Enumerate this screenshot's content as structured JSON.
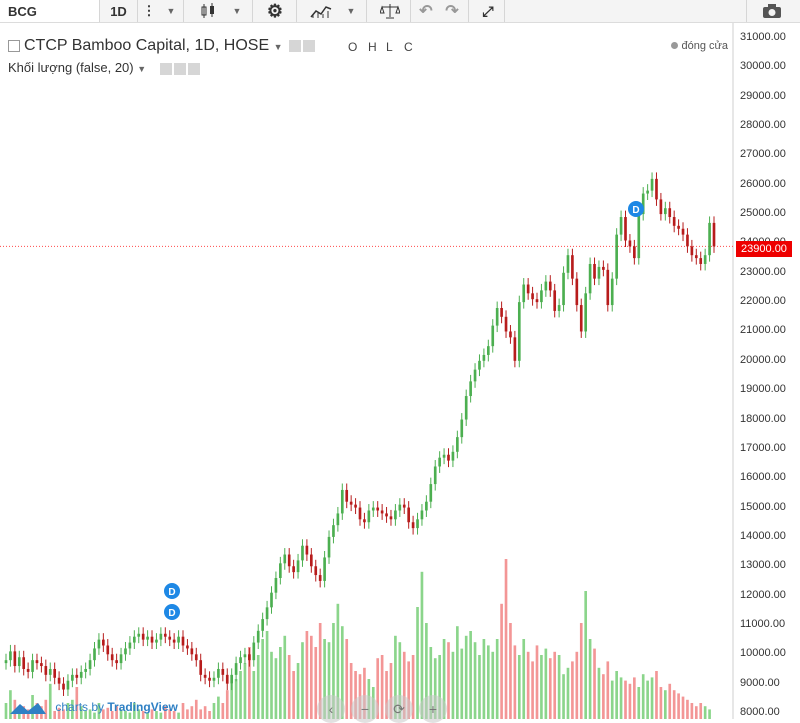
{
  "toolbar": {
    "symbol": "BCG",
    "resolution": "1D",
    "icons": [
      "more-icon",
      "candlestick-icon",
      "settings-icon",
      "indicators-icon",
      "compare-icon",
      "undo-icon",
      "redo-icon",
      "fullscreen-icon",
      "camera-icon"
    ]
  },
  "legend": {
    "title": "CTCP Bamboo Capital, 1D, HOSE",
    "ohlc": [
      "O",
      "H",
      "L",
      "C"
    ],
    "volume": "Khối lượng (false, 20)",
    "close_label": "đóng cửa"
  },
  "last_price": "23900.00",
  "branding": {
    "prefix": "charts by",
    "name": "TradingView"
  },
  "markers": [
    "D",
    "D",
    "D"
  ],
  "colors": {
    "up": "#4caf50",
    "down": "#b71c1c",
    "vol_up": "#7ed07e",
    "vol_down": "#f28b8b",
    "price_line": "#ff4a4a"
  },
  "chart_data": {
    "type": "candlestick",
    "title": "CTCP Bamboo Capital, 1D, HOSE",
    "y_ticks": [
      "31000.00",
      "30000.00",
      "29000.00",
      "28000.00",
      "27000.00",
      "26000.00",
      "25000.00",
      "24000.00",
      "23000.00",
      "22000.00",
      "21000.00",
      "20000.00",
      "19000.00",
      "18000.00",
      "17000.00",
      "16000.00",
      "15000.00",
      "14000.00",
      "13000.00",
      "12000.00",
      "11000.00",
      "10000.00",
      "9000.00",
      "8000.00"
    ],
    "ylim": [
      8000,
      31300
    ],
    "grid": false,
    "close": [
      9800,
      10100,
      9600,
      9900,
      9500,
      9400,
      9800,
      9700,
      9600,
      9300,
      9500,
      9200,
      9000,
      8800,
      9100,
      9300,
      9200,
      9400,
      9500,
      9800,
      10200,
      10500,
      10300,
      10000,
      9800,
      9700,
      10000,
      10200,
      10400,
      10600,
      10700,
      10500,
      10600,
      10400,
      10500,
      10700,
      10600,
      10500,
      10400,
      10600,
      10300,
      10200,
      10000,
      9800,
      9300,
      9200,
      9100,
      9200,
      9500,
      9300,
      9000,
      9300,
      9700,
      9900,
      10000,
      9800,
      10400,
      10800,
      11200,
      11600,
      12100,
      12600,
      13100,
      13400,
      13000,
      12800,
      13200,
      13700,
      13400,
      13000,
      12700,
      12500,
      13300,
      14000,
      14400,
      14800,
      15600,
      15200,
      15100,
      15000,
      14600,
      14500,
      14900,
      15000,
      14900,
      14800,
      14700,
      14600,
      14900,
      15100,
      15000,
      14500,
      14300,
      14600,
      14900,
      15200,
      15800,
      16400,
      16700,
      16800,
      16600,
      16900,
      17400,
      18000,
      18800,
      19300,
      19700,
      20000,
      20200,
      20500,
      21200,
      21800,
      21500,
      21000,
      20800,
      20000,
      22000,
      22600,
      22300,
      22100,
      22000,
      22400,
      22700,
      22400,
      21700,
      21900,
      23000,
      23600,
      22800,
      21900,
      21000,
      22300,
      23300,
      22800,
      23200,
      23100,
      21900,
      22800,
      24300,
      24900,
      24100,
      23900,
      23500,
      25000,
      25700,
      25800,
      26200,
      25500,
      25000,
      25200,
      24900,
      24600,
      24500,
      24300,
      23900,
      23600,
      23500,
      23300,
      23600,
      24700,
      23900
    ],
    "volume_ratio": [
      0.1,
      0.18,
      0.12,
      0.05,
      0.08,
      0.06,
      0.15,
      0.1,
      0.08,
      0.12,
      0.22,
      0.05,
      0.07,
      0.06,
      0.1,
      0.12,
      0.2,
      0.08,
      0.05,
      0.06,
      0.04,
      0.1,
      0.06,
      0.07,
      0.05,
      0.08,
      0.06,
      0.05,
      0.04,
      0.1,
      0.06,
      0.05,
      0.04,
      0.06,
      0.05,
      0.04,
      0.08,
      0.06,
      0.05,
      0.04,
      0.1,
      0.06,
      0.08,
      0.12,
      0.06,
      0.08,
      0.05,
      0.1,
      0.14,
      0.1,
      0.18,
      0.22,
      0.25,
      0.3,
      0.35,
      0.45,
      0.3,
      0.4,
      0.5,
      0.55,
      0.42,
      0.38,
      0.45,
      0.52,
      0.4,
      0.3,
      0.35,
      0.48,
      0.55,
      0.52,
      0.45,
      0.6,
      0.5,
      0.48,
      0.6,
      0.72,
      0.58,
      0.5,
      0.35,
      0.3,
      0.28,
      0.32,
      0.25,
      0.2,
      0.38,
      0.4,
      0.3,
      0.35,
      0.52,
      0.48,
      0.42,
      0.36,
      0.4,
      0.7,
      0.92,
      0.6,
      0.45,
      0.38,
      0.4,
      0.5,
      0.48,
      0.42,
      0.58,
      0.44,
      0.52,
      0.55,
      0.48,
      0.4,
      0.5,
      0.46,
      0.42,
      0.5,
      0.72,
      1.0,
      0.6,
      0.46,
      0.4,
      0.5,
      0.42,
      0.36,
      0.46,
      0.4,
      0.44,
      0.38,
      0.42,
      0.4,
      0.28,
      0.32,
      0.36,
      0.42,
      0.6,
      0.8,
      0.5,
      0.44,
      0.32,
      0.28,
      0.36,
      0.24,
      0.3,
      0.26,
      0.24,
      0.22,
      0.26,
      0.2,
      0.28,
      0.24,
      0.26,
      0.3,
      0.2,
      0.18,
      0.22,
      0.18,
      0.16,
      0.14,
      0.12,
      0.1,
      0.08,
      0.1,
      0.08,
      0.06
    ],
    "last_price": 23900
  }
}
